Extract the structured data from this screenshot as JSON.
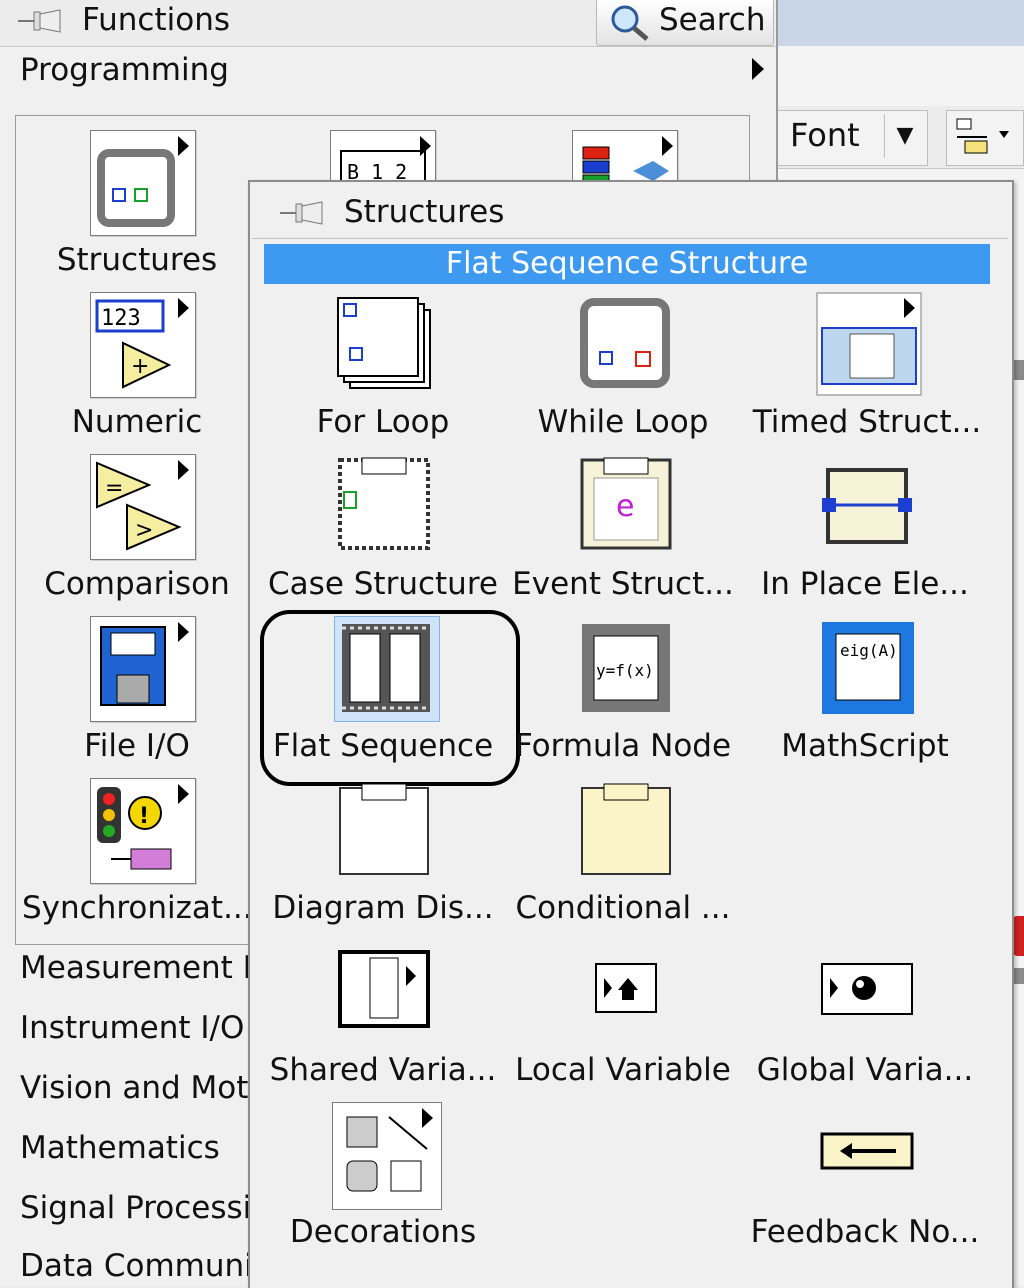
{
  "functions_palette": {
    "title": "Functions",
    "search_label": "Search",
    "programming_label": "Programming",
    "left_items": [
      {
        "label": "Structures",
        "icon": "structures-icon"
      },
      {
        "label": "Numeric",
        "icon": "numeric-icon"
      },
      {
        "label": "Comparison",
        "icon": "comparison-icon"
      },
      {
        "label": "File I/O",
        "icon": "file-io-icon"
      },
      {
        "label": "Synchronizat...",
        "icon": "synchronization-icon"
      }
    ],
    "categories": [
      "Measurement I",
      "Instrument I/O",
      "Vision and Mot",
      "Mathematics",
      "Signal Processi",
      "Data Communi"
    ]
  },
  "toolbar": {
    "font_label": "Font"
  },
  "structures_palette": {
    "title": "Structures",
    "tooltip": "Flat Sequence Structure",
    "items": [
      {
        "label": "For Loop",
        "icon": "for-loop-icon"
      },
      {
        "label": "While Loop",
        "icon": "while-loop-icon"
      },
      {
        "label": "Timed Struct...",
        "icon": "timed-structure-icon"
      },
      {
        "label": "Case Structure",
        "icon": "case-structure-icon"
      },
      {
        "label": "Event Struct...",
        "icon": "event-structure-icon"
      },
      {
        "label": "In Place Ele...",
        "icon": "in-place-element-icon"
      },
      {
        "label": "Flat Sequence",
        "icon": "flat-sequence-icon"
      },
      {
        "label": "Formula Node",
        "icon": "formula-node-icon"
      },
      {
        "label": "MathScript",
        "icon": "mathscript-icon"
      },
      {
        "label": "Diagram Dis...",
        "icon": "diagram-disable-icon"
      },
      {
        "label": "Conditional ...",
        "icon": "conditional-disable-icon"
      },
      {
        "label": "Shared Varia...",
        "icon": "shared-variable-icon"
      },
      {
        "label": "Local Variable",
        "icon": "local-variable-icon"
      },
      {
        "label": "Global Varia...",
        "icon": "global-variable-icon"
      },
      {
        "label": "Decorations",
        "icon": "decorations-icon"
      },
      {
        "label": "Feedback No...",
        "icon": "feedback-node-icon"
      }
    ],
    "icon_texts": {
      "numeric_digits": "123",
      "formula": "y=f(x)",
      "mathscript": "eig(A)",
      "event": "e",
      "sequence_frames": "B 1 2"
    }
  },
  "colors": {
    "tooltip_bg": "#3d9af0",
    "panel_bg": "#f0f0f0",
    "ring": "#000000"
  }
}
